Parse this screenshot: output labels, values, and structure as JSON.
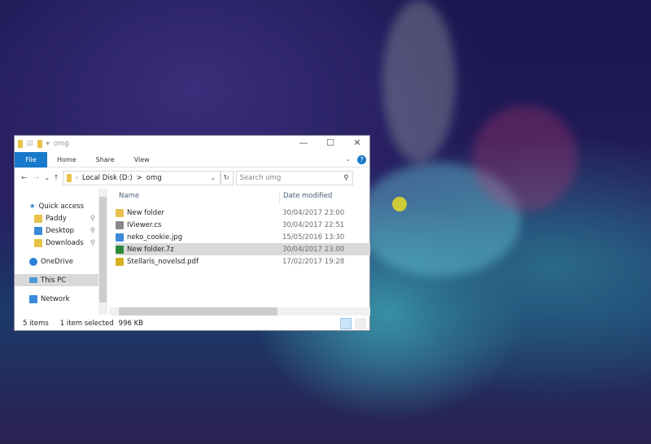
{
  "window": {
    "title": "omg",
    "controls": {
      "minimize": "—",
      "maximize": "☐",
      "close": "✕"
    }
  },
  "ribbon": {
    "tabs": [
      "File",
      "Home",
      "Share",
      "View"
    ],
    "help": "?"
  },
  "address": {
    "path": [
      "Local Disk (D:)",
      "omg"
    ],
    "separator": ">",
    "search_placeholder": "Search omg"
  },
  "nav": {
    "items": [
      {
        "label": "Quick access"
      },
      {
        "label": "Paddy"
      },
      {
        "label": "Desktop"
      },
      {
        "label": "Downloads"
      },
      {
        "label": "OneDrive"
      },
      {
        "label": "This PC"
      },
      {
        "label": "Network"
      }
    ]
  },
  "columns": {
    "name": "Name",
    "date": "Date modified"
  },
  "files": [
    {
      "name": "New folder",
      "date": "30/04/2017 23:00",
      "color": "#e8c14a"
    },
    {
      "name": "IViewer.cs",
      "date": "30/04/2017 22:51",
      "color": "#888888"
    },
    {
      "name": "neko_cookie.jpg",
      "date": "15/05/2016 13:30",
      "color": "#3a8ad8"
    },
    {
      "name": "New folder.7z",
      "date": "30/04/2017 23:00",
      "color": "#2a8a3a"
    },
    {
      "name": "Stellaris_novelsd.pdf",
      "date": "17/02/2017 19:28",
      "color": "#d8b020"
    }
  ],
  "status": {
    "count": "5 items",
    "selected": "1 item selected",
    "size": "996 KB"
  }
}
